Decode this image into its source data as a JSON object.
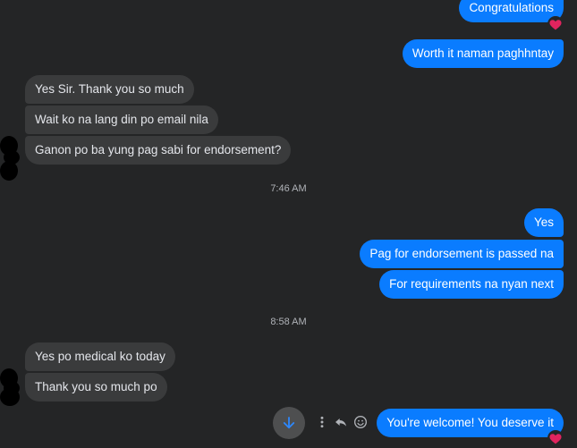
{
  "messages": {
    "out_congrats": "Congratulations",
    "out_worth": "Worth it naman paghhntay",
    "in_yes_sir": "Yes Sir. Thank you so much",
    "in_wait": "Wait ko na lang din po email nila",
    "in_ganon": "Ganon po ba yung pag sabi for endorsement?",
    "out_yes": "Yes",
    "out_pag": "Pag for endorsement is passed na",
    "out_for_req": "For requirements na nyan next",
    "in_medical": "Yes po medical ko today",
    "in_thank_you": "Thank you so much po",
    "out_welcome": "You're welcome! You deserve it"
  },
  "timestamps": {
    "t1": "7:46 AM",
    "t2": "8:58 AM"
  },
  "reactions": {
    "congrats": "heart",
    "welcome": "heart"
  },
  "colors": {
    "background": "#242526",
    "outgoing_bubble": "#0a7cff",
    "incoming_bubble": "#3a3b3c",
    "heart": "#e0245e",
    "scroll_arrow": "#2d88ff"
  },
  "icons": {
    "scroll_down": "arrow-down-icon",
    "more": "more-vertical-icon",
    "reply": "reply-icon",
    "react": "smiley-icon"
  }
}
